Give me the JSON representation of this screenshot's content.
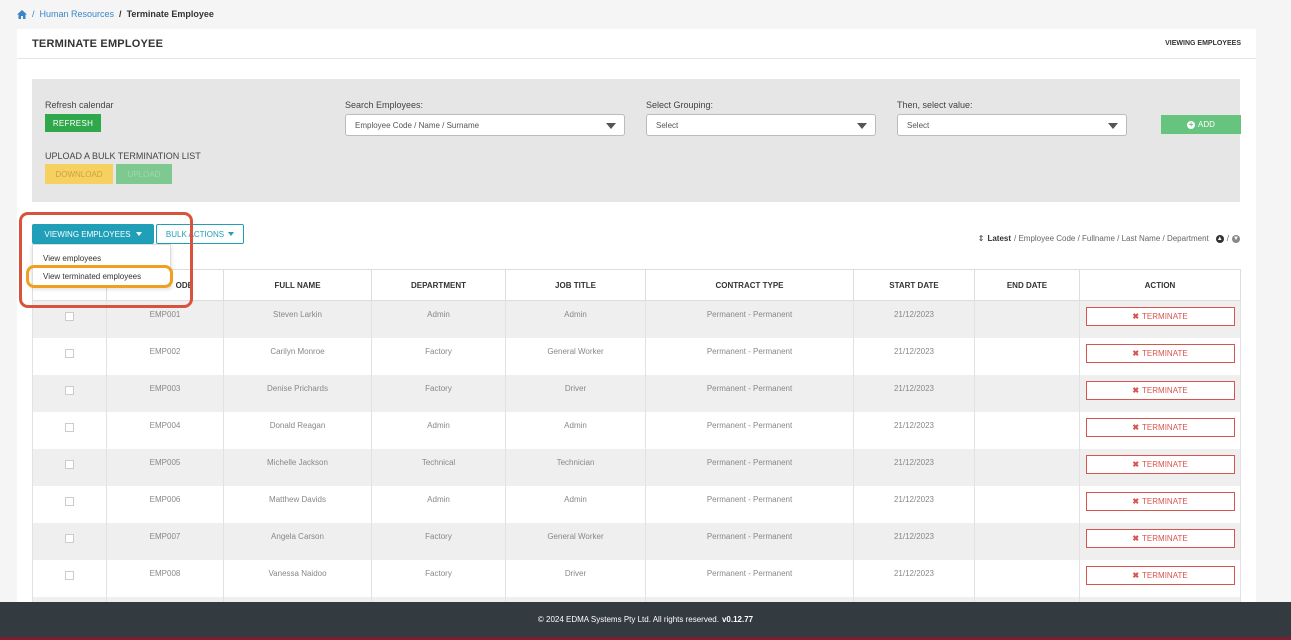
{
  "breadcrumb": {
    "sep1": "/",
    "link": "Human Resources",
    "sep2": "/",
    "current": "Terminate Employee"
  },
  "card": {
    "title": "TERMINATE EMPLOYEE",
    "header_right": "VIEWING EMPLOYEES"
  },
  "filters": {
    "refresh_label": "Refresh calendar",
    "refresh_button": "REFRESH",
    "search_label": "Search Employees:",
    "search_value": "Employee Code / Name / Surname",
    "grouping_label": "Select Grouping:",
    "grouping_value": "Select",
    "value_label": "Then, select value:",
    "value_value": "Select",
    "add_button": "ADD",
    "upload_label": "UPLOAD A BULK TERMINATION LIST",
    "download_button": "DOWNLOAD",
    "upload_button": "UPLOAD"
  },
  "toolbar": {
    "viewing_button": "VIEWING EMPLOYEES",
    "bulk_button": "BULK ACTIONS"
  },
  "dropdown": {
    "items": [
      "View employees",
      "View terminated employees"
    ]
  },
  "sort": {
    "latest": "Latest",
    "options": "/ Employee Code / Fullname / Last Name / Department",
    "sep": "/"
  },
  "table": {
    "headers": [
      "",
      "EMPLOYEE CODE",
      "FULL NAME",
      "DEPARTMENT",
      "JOB TITLE",
      "CONTRACT TYPE",
      "START DATE",
      "END DATE",
      "ACTION"
    ],
    "visible_header_code": "ODE",
    "rows": [
      {
        "code": "EMP001",
        "name": "Steven Larkin",
        "dept": "Admin",
        "title": "Admin",
        "contract": "Permanent - Permanent",
        "start": "21/12/2023",
        "end": "",
        "action": "TERMINATE"
      },
      {
        "code": "EMP002",
        "name": "Carilyn Monroe",
        "dept": "Factory",
        "title": "General Worker",
        "contract": "Permanent - Permanent",
        "start": "21/12/2023",
        "end": "",
        "action": "TERMINATE"
      },
      {
        "code": "EMP003",
        "name": "Denise Prichards",
        "dept": "Factory",
        "title": "Driver",
        "contract": "Permanent - Permanent",
        "start": "21/12/2023",
        "end": "",
        "action": "TERMINATE"
      },
      {
        "code": "EMP004",
        "name": "Donald Reagan",
        "dept": "Admin",
        "title": "Admin",
        "contract": "Permanent - Permanent",
        "start": "21/12/2023",
        "end": "",
        "action": "TERMINATE"
      },
      {
        "code": "EMP005",
        "name": "Michelle Jackson",
        "dept": "Technical",
        "title": "Technician",
        "contract": "Permanent - Permanent",
        "start": "21/12/2023",
        "end": "",
        "action": "TERMINATE"
      },
      {
        "code": "EMP006",
        "name": "Matthew Davids",
        "dept": "Admin",
        "title": "Admin",
        "contract": "Permanent - Permanent",
        "start": "21/12/2023",
        "end": "",
        "action": "TERMINATE"
      },
      {
        "code": "EMP007",
        "name": "Angela Carson",
        "dept": "Factory",
        "title": "General Worker",
        "contract": "Permanent - Permanent",
        "start": "21/12/2023",
        "end": "",
        "action": "TERMINATE"
      },
      {
        "code": "EMP008",
        "name": "Vanessa Naidoo",
        "dept": "Factory",
        "title": "Driver",
        "contract": "Permanent - Permanent",
        "start": "21/12/2023",
        "end": "",
        "action": "TERMINATE"
      }
    ]
  },
  "footer": {
    "text": "© 2024 EDMA Systems Pty Ltd. All rights reserved.",
    "version": "v0.12.77"
  },
  "colors": {
    "accent": "#1f9fb8",
    "refresh": "#2ea84a",
    "add": "#66c47e",
    "download": "#f7d15f",
    "terminate": "#d9534f",
    "footer": "#333a40",
    "highlight_red": "#d9533c",
    "highlight_orange": "#f0a020"
  },
  "icons": {
    "home": "home-icon",
    "caret": "caret-down-icon",
    "sort": "sort-arrows-icon",
    "remove": "times-icon",
    "plus": "plus-circle-icon"
  }
}
